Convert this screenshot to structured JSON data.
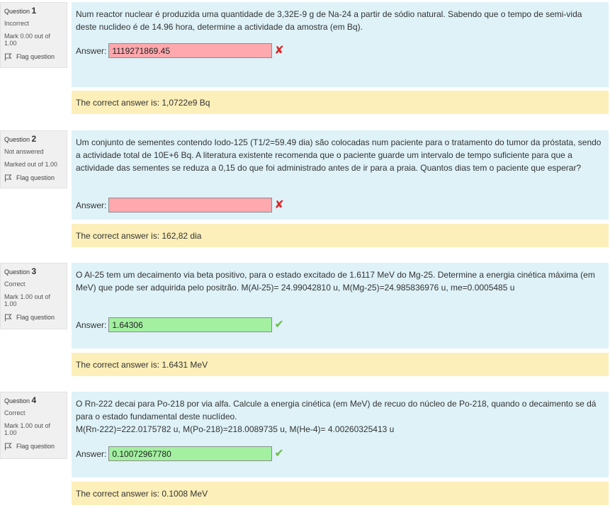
{
  "flag_label": "Flag question",
  "answer_label": "Answer:",
  "questions": [
    {
      "number_prefix": "Question",
      "number": "1",
      "state": "Incorrect",
      "grade": "Mark 0.00 out of 1.00",
      "text": "Num reactor nuclear é produzida uma quantidade de 3,32E-9 g de Na-24 a partir de sódio natural. Sabendo que o tempo de semi-vida deste nuclideo é de 14.96 hora, determine a actividade da amostra (em Bq).",
      "answer": "1119271869.45",
      "result": "incorrect",
      "mark_icon": "✘",
      "feedback": "The correct answer is: 1,0722e9 Bq"
    },
    {
      "number_prefix": "Question",
      "number": "2",
      "state": "Not answered",
      "grade": "Marked out of 1.00",
      "text": "Um conjunto de sementes contendo Iodo-125 (T1/2=59.49 dia) são colocadas num paciente para o tratamento do tumor da próstata, sendo a actividade total de 10E+6 Bq. A literatura existente recomenda que o paciente guarde um intervalo de tempo suficiente para que a actividade das sementes se reduza a 0,15 do que foi administrado antes de ir para a praia. Quantos dias tem o paciente que esperar?",
      "answer": "",
      "result": "incorrect",
      "mark_icon": "✘",
      "feedback": "The correct answer is: 162,82 dia"
    },
    {
      "number_prefix": "Question",
      "number": "3",
      "state": "Correct",
      "grade": "Mark 1.00 out of 1.00",
      "text": "O Al-25 tem um decaimento via beta positivo, para o estado excitado de 1.6117 MeV do Mg-25. Determine a energia cinética máxima (em MeV) que pode ser adquirida pelo positrão. M(Al-25)= 24.99042810 u, M(Mg-25)=24.985836976 u, me=0.0005485 u",
      "answer": "1.64306",
      "result": "correct",
      "mark_icon": "✔",
      "feedback": "The correct answer is: 1.6431 MeV"
    },
    {
      "number_prefix": "Question",
      "number": "4",
      "state": "Correct",
      "grade": "Mark 1.00 out of 1.00",
      "text_line1": "O Rn-222 decai para Po-218 por via alfa. Calcule a energia cinética (em MeV) de recuo do núcleo de Po-218, quando o decaimento se dá para o estado fundamental deste nuclídeo.",
      "text_line2": "M(Rn-222)=222.0175782 u, M(Po-218)=218.0089735 u, M(He-4)= 4.00260325413 u",
      "answer": "0.10072967780",
      "result": "correct",
      "mark_icon": "✔",
      "feedback": "The correct answer is: 0.1008 MeV"
    }
  ]
}
